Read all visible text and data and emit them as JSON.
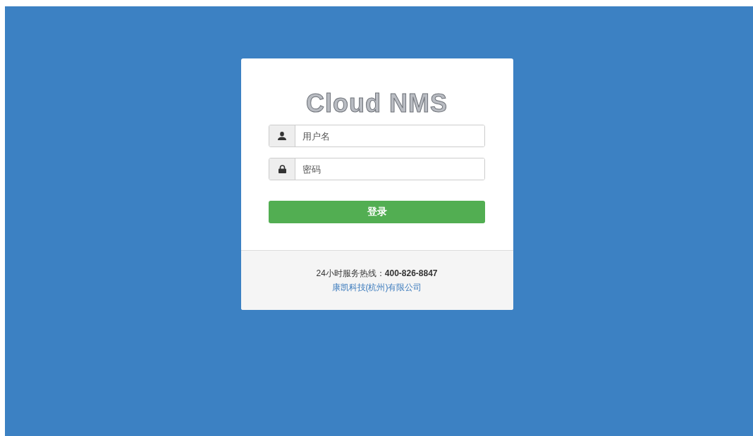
{
  "logo": "Cloud NMS",
  "fields": [
    {
      "kind": "user",
      "placeholder": "用户名"
    },
    {
      "kind": "password",
      "placeholder": "密码"
    }
  ],
  "login_button": "登录",
  "footer": {
    "hotline": "24小时服务热线：**400-826-8847**",
    "company": "康凯科技(杭州)有限公司"
  }
}
